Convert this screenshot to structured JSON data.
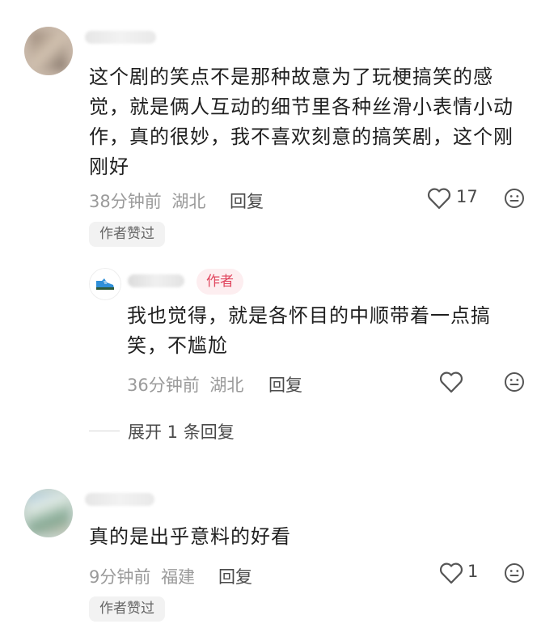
{
  "comments": [
    {
      "text": "这个剧的笑点不是那种故意为了玩梗搞笑的感觉，就是俩人互动的细节里各种丝滑小表情小动作，真的很妙，我不喜欢刻意的搞笑剧，这个刚刚好",
      "time": "38分钟前",
      "location": "湖北",
      "reply_label": "回复",
      "likes": "17",
      "liked_tag": "作者赞过",
      "replies": [
        {
          "name_partial": "ﾞ..--ﾞ",
          "badge": "作者",
          "text": "我也觉得，就是各怀目的中顺带着一点搞笑，不尴尬",
          "time": "36分钟前",
          "location": "湖北",
          "reply_label": "回复"
        }
      ],
      "expand_label": "展开 1 条回复"
    },
    {
      "text": "真的是出乎意料的好看",
      "time": "9分钟前",
      "location": "福建",
      "reply_label": "回复",
      "likes": "1",
      "liked_tag": "作者赞过"
    }
  ],
  "icons": {
    "like": "heart-outline-icon",
    "emoji": "emoji-neutral-icon",
    "avatar_reply": "sneaker-icon"
  }
}
